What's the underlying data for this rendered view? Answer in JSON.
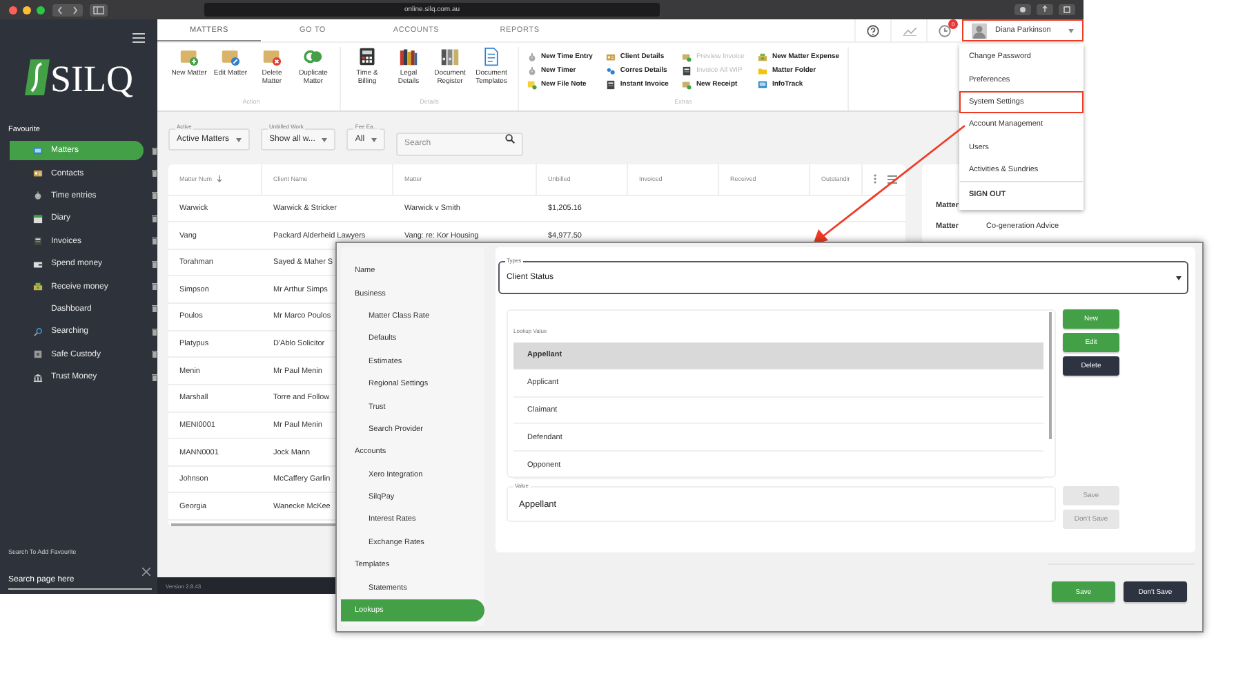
{
  "browser": {
    "url": "online.silq.com.au"
  },
  "sidebar": {
    "logo": "SILQ",
    "section": "Favourite",
    "items": [
      {
        "label": "Matters",
        "selected": true
      },
      {
        "label": "Contacts",
        "selected": false
      },
      {
        "label": "Time entries",
        "selected": false
      },
      {
        "label": "Diary",
        "selected": false
      },
      {
        "label": "Invoices",
        "selected": false
      },
      {
        "label": "Spend money",
        "selected": false
      },
      {
        "label": "Receive money",
        "selected": false
      },
      {
        "label": "Dashboard",
        "selected": false
      },
      {
        "label": "Searching",
        "selected": false
      },
      {
        "label": "Safe Custody",
        "selected": false
      },
      {
        "label": "Trust Money",
        "selected": false
      }
    ],
    "search_label": "Search To Add Favourite",
    "search_placeholder": "Search page here"
  },
  "tabs": [
    {
      "label": "MATTERS",
      "selected": true
    },
    {
      "label": "GO TO",
      "selected": false
    },
    {
      "label": "ACCOUNTS",
      "selected": false
    },
    {
      "label": "REPORTS",
      "selected": false
    }
  ],
  "ribbon": {
    "groups": [
      {
        "caption": "Action",
        "kind": "large",
        "items": [
          {
            "label": "New Matter"
          },
          {
            "label": "Edit Matter"
          },
          {
            "label": "Delete Matter"
          },
          {
            "label": "Duplicate Matter"
          }
        ]
      },
      {
        "caption": "Details",
        "kind": "large",
        "items": [
          {
            "label": "Time & Billing"
          },
          {
            "label": "Legal Details"
          },
          {
            "label": "Document Register"
          },
          {
            "label": "Document Templates"
          }
        ]
      },
      {
        "caption": "Extras",
        "kind": "small",
        "items": [
          {
            "label": "New Time Entry",
            "disabled": false
          },
          {
            "label": "New Timer",
            "disabled": false
          },
          {
            "label": "New File Note",
            "disabled": false
          },
          {
            "label": "Client Details",
            "disabled": false
          },
          {
            "label": "Corres Details",
            "disabled": false
          },
          {
            "label": "Instant Invoice",
            "disabled": false
          },
          {
            "label": "Preview Invoice",
            "disabled": true
          },
          {
            "label": "Invoice All WIP",
            "disabled": true
          },
          {
            "label": "New Receipt",
            "disabled": false
          },
          {
            "label": "New Matter Expense",
            "disabled": false
          },
          {
            "label": "Matter Folder",
            "disabled": false
          },
          {
            "label": "InfoTrack",
            "disabled": false
          }
        ]
      }
    ]
  },
  "header": {
    "notification_count": "0",
    "user": {
      "name": "Diana Parkinson",
      "highlighted": true
    }
  },
  "user_menu": {
    "items": [
      {
        "label": "Change Password",
        "kind": "item",
        "highlighted": false
      },
      {
        "label": "Preferences",
        "kind": "item",
        "highlighted": false
      },
      {
        "label": "System Settings",
        "kind": "item",
        "highlighted": true
      },
      {
        "label": "Account Management",
        "kind": "item",
        "highlighted": false
      },
      {
        "label": "Users",
        "kind": "item",
        "highlighted": false
      },
      {
        "label": "Activities & Sundries",
        "kind": "item",
        "highlighted": false
      },
      {
        "label": "SIGN OUT",
        "kind": "signout",
        "highlighted": false
      }
    ]
  },
  "filters": [
    {
      "label": "Active",
      "value": "Active Matters"
    },
    {
      "label": "Unbilled Work",
      "value": "Show all w..."
    },
    {
      "label": "Fee Ea...",
      "value": "All"
    }
  ],
  "search": {
    "placeholder": "Search"
  },
  "table": {
    "columns": [
      {
        "label": "Matter Num",
        "sorted": true
      },
      {
        "label": "Client Name",
        "sorted": false
      },
      {
        "label": "Matter",
        "sorted": false
      },
      {
        "label": "Unbilled",
        "sorted": false
      },
      {
        "label": "Invoiced",
        "sorted": false
      },
      {
        "label": "Received",
        "sorted": false
      },
      {
        "label": "Outstandir",
        "sorted": false
      }
    ],
    "rows": [
      [
        "Warwick",
        "Warwick & Stricker",
        "Warwick v Smith",
        "$1,205.16"
      ],
      [
        "Vang",
        "Packard Alderheid Lawyers",
        "Vang: re: Kor Housing",
        "$4,977.50"
      ],
      [
        "Torahman",
        "Sayed & Maher S"
      ],
      [
        "Simpson",
        "Mr Arthur Simps"
      ],
      [
        "Poulos",
        "Mr Marco Poulos"
      ],
      [
        "Platypus",
        "D'Ablo Solicitor"
      ],
      [
        "Menin",
        "Mr Paul Menin"
      ],
      [
        "Marshall",
        "Torre and Follow"
      ],
      [
        "MENI0001",
        "Mr Paul Menin"
      ],
      [
        "MANN0001",
        "Jock Mann"
      ],
      [
        "Johnson",
        "McCaffery Garlin"
      ],
      [
        "Georgia",
        "Wanecke McKee"
      ]
    ]
  },
  "details": [
    {
      "label": "Matter"
    },
    {
      "label": "Matter",
      "value": "Co-generation Advice"
    }
  ],
  "status_bar": {
    "version": "Version 2.8.43"
  },
  "settings": {
    "nav": [
      {
        "label": "Name",
        "selected": false
      },
      {
        "label": "Business",
        "selected": false,
        "children": [
          {
            "label": "Matter Class Rate",
            "selected": false
          },
          {
            "label": "Defaults",
            "selected": false
          },
          {
            "label": "Estimates",
            "selected": false
          },
          {
            "label": "Regional Settings",
            "selected": false
          },
          {
            "label": "Trust",
            "selected": false
          },
          {
            "label": "Search Provider",
            "selected": false
          }
        ]
      },
      {
        "label": "Accounts",
        "selected": false,
        "children": [
          {
            "label": "Xero Integration",
            "selected": false
          },
          {
            "label": "SilqPay",
            "selected": false
          },
          {
            "label": "Interest Rates",
            "selected": false
          },
          {
            "label": "Exchange Rates",
            "selected": false
          }
        ]
      },
      {
        "label": "Templates",
        "selected": false,
        "children": [
          {
            "label": "Statements",
            "selected": false
          }
        ]
      },
      {
        "label": "Lookups",
        "selected": true
      }
    ],
    "types": {
      "label": "Types",
      "value": "Client Status"
    },
    "lookup": {
      "header": "Lookup Value",
      "items": [
        {
          "label": "Appellant",
          "selected": true
        },
        {
          "label": "Applicant",
          "selected": false
        },
        {
          "label": "Claimant",
          "selected": false
        },
        {
          "label": "Defendant",
          "selected": false
        },
        {
          "label": "Opponent",
          "selected": false
        }
      ]
    },
    "list_buttons": [
      {
        "label": "New",
        "kind": "primary"
      },
      {
        "label": "Edit",
        "kind": "primary"
      },
      {
        "label": "Delete",
        "kind": "dark"
      }
    ],
    "value_field": {
      "label": "Value",
      "value": "Appellant"
    },
    "value_buttons": [
      {
        "label": "Save",
        "disabled": true
      },
      {
        "label": "Don't Save",
        "disabled": true
      }
    ],
    "footer_buttons": [
      {
        "label": "Save",
        "kind": "primary"
      },
      {
        "label": "Don't Save",
        "kind": "dark"
      }
    ]
  }
}
